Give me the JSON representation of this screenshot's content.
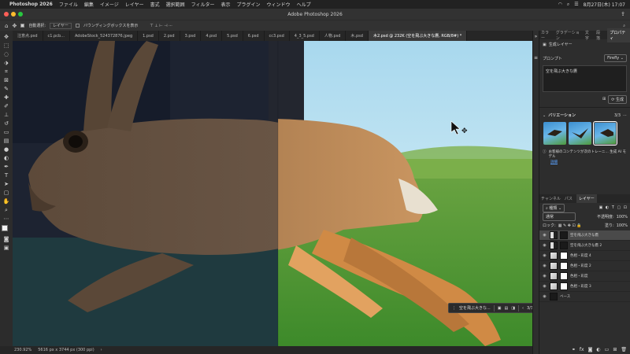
{
  "menubar": {
    "app_name": "Photoshop 2026",
    "items": [
      "ファイル",
      "編集",
      "イメージ",
      "レイヤー",
      "書式",
      "選択範囲",
      "フィルター",
      "表示",
      "プラグイン",
      "ウィンドウ",
      "ヘルプ"
    ],
    "datetime": "8月27日(木) 17:07"
  },
  "window_title": "Adobe Photoshop 2026",
  "options": {
    "auto_select_label": "自動選択:",
    "auto_select_value": "レイヤー",
    "bounding_box_label": "バウンディングボックスを表示"
  },
  "tabs": [
    "注意点.psd",
    "c1.pcb...",
    "AdobeStock_524372876.jpeg",
    "1.psd",
    "2.psd",
    "3.psd",
    "4.psd",
    "5.psd",
    "6.psd",
    "cc3.psd",
    "4_3_5.psd",
    "人物.psd",
    "木.psd",
    "木2.psd @ 232K (空を飛ぶ大きな鷹, RGB/8#) *"
  ],
  "status": {
    "zoom": "230.92%",
    "doc_info": "5616 px x 3744 px (300 ppi)"
  },
  "context_bar": {
    "prompt_text": "空を飛ぶ大きな...",
    "page": "3/3",
    "generate_label": "生成"
  },
  "properties_panel": {
    "tabs": [
      "カラー",
      "グラデーション",
      "文字",
      "段落",
      "プロパティ"
    ],
    "layer_kind": "生成レイヤー",
    "prompt_label": "プロンプト",
    "model": "Firefly",
    "prompt_text": "空を飛ぶ大きな鷹",
    "generate_label": "生成",
    "variations_label": "バリエーション",
    "variations_count": "3/3",
    "notice": "お客様のコンテンツが次のトレーニ... 生成 AI モデル",
    "notice_link": "詳細"
  },
  "layers_panel": {
    "tabs": [
      "チャンネル",
      "パス",
      "レイヤー"
    ],
    "filter_label": "種類",
    "blend_mode": "通常",
    "opacity_label": "不透明度:",
    "opacity": "100%",
    "lock_label": "ロック:",
    "fill_label": "塗り:",
    "fill": "100%",
    "layers": [
      {
        "name": "空を飛ぶ大きな鷹",
        "thumb": "mix",
        "active": true
      },
      {
        "name": "空を飛ぶ大きな鷹 2",
        "thumb": "mix",
        "active": false
      },
      {
        "name": "色相・彩度 4",
        "thumb": "img",
        "active": false
      },
      {
        "name": "色相・彩度 2",
        "thumb": "img",
        "active": false
      },
      {
        "name": "色相・彩度",
        "thumb": "img",
        "active": false
      },
      {
        "name": "色相・彩度 3",
        "thumb": "img",
        "active": false
      },
      {
        "name": "ベース",
        "thumb": "dark",
        "active": false
      }
    ]
  },
  "colors": {
    "accent": "#3b8ce0",
    "panel": "#2d2d2d",
    "toolbar": "#2c2c2c"
  }
}
